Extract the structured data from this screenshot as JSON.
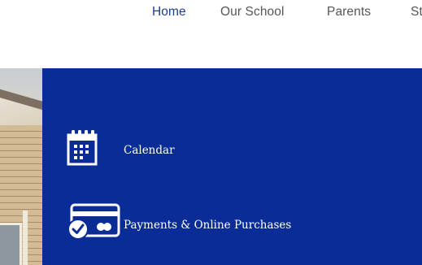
{
  "nav": {
    "items": [
      {
        "label": "Home",
        "active": true
      },
      {
        "label": "Our School",
        "active": false
      },
      {
        "label": "Parents",
        "active": false
      },
      {
        "label": "St",
        "active": false
      }
    ]
  },
  "quick_links": [
    {
      "label": "Calendar",
      "icon": "calendar-icon"
    },
    {
      "label": "Payments & Online Purchases",
      "icon": "payment-card-icon"
    }
  ],
  "colors": {
    "panel_background": "#0a2c96",
    "nav_active": "#1f3c88",
    "nav_text": "#555555",
    "link_text": "#ffffff"
  }
}
